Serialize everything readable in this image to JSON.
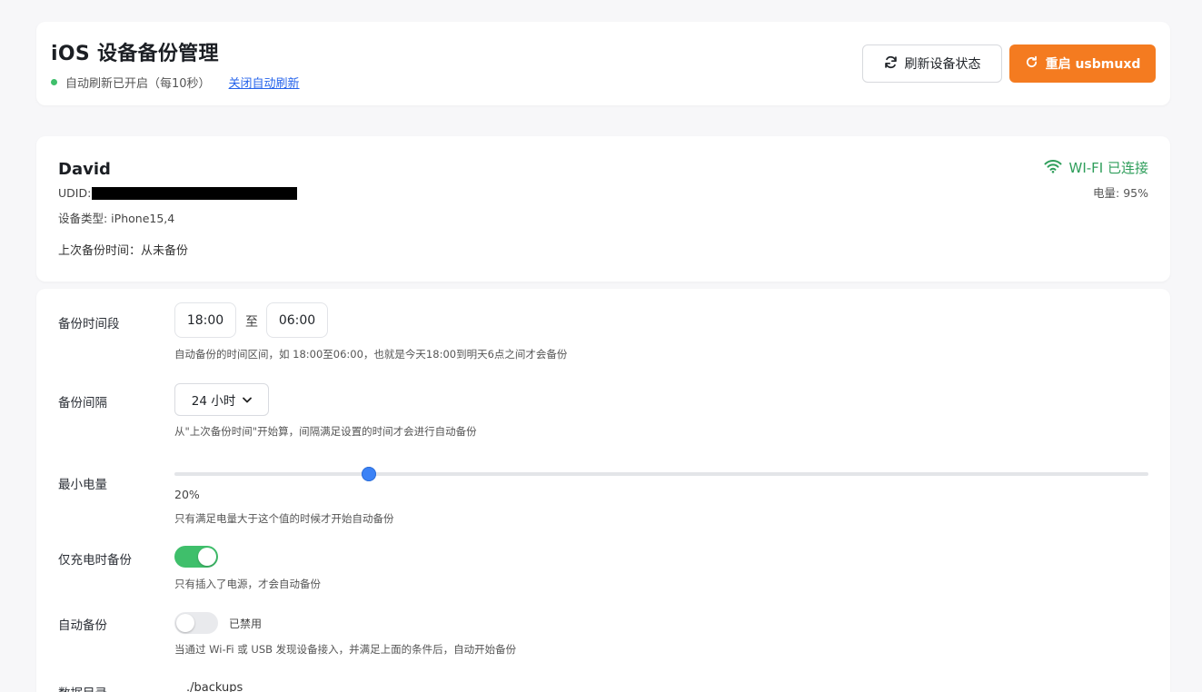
{
  "header": {
    "title": "iOS 设备备份管理",
    "status_text": "自动刷新已开启（每10秒）",
    "toggle_link": "关闭自动刷新",
    "refresh_button": "刷新设备状态",
    "restart_button": "重启 usbmuxd",
    "colors": {
      "status_dot": "#3fbf6b",
      "link": "#2563eb",
      "restart_bg": "#f47b20"
    }
  },
  "device": {
    "name": "David",
    "udid_label": "UDID:",
    "model": "设备类型: iPhone15,4",
    "last_backup_label": "上次备份时间：",
    "last_backup_value": "从未备份",
    "connection": "WI-FI 已连接",
    "battery": "电量: 95%",
    "colors": {
      "connection": "#2f9e5b"
    }
  },
  "settings": {
    "window": {
      "label": "备份时间段",
      "start": "18:00",
      "separator": "至",
      "end": "06:00",
      "hint": "自动备份的时间区间，如 18:00至06:00，也就是今天18:00到明天6点之间才会备份"
    },
    "interval": {
      "label": "备份间隔",
      "selected": "24 小时",
      "hint": "从\"上次备份时间\"开始算，间隔满足设置的时间才会进行自动备份"
    },
    "min_battery": {
      "label": "最小电量",
      "value": 20,
      "value_text": "20%",
      "hint": "只有满足电量大于这个值的时候才开始自动备份"
    },
    "charging_only": {
      "label": "仅充电时备份",
      "enabled": true,
      "hint": "只有插入了电源，才会自动备份"
    },
    "auto_backup": {
      "label": "自动备份",
      "enabled": false,
      "state_text": "已禁用",
      "hint": "当通过 Wi-Fi 或 USB 发现设备接入，并满足上面的条件后，自动开始备份"
    },
    "data_dir": {
      "label": "数据目录",
      "value": "./backups"
    }
  }
}
